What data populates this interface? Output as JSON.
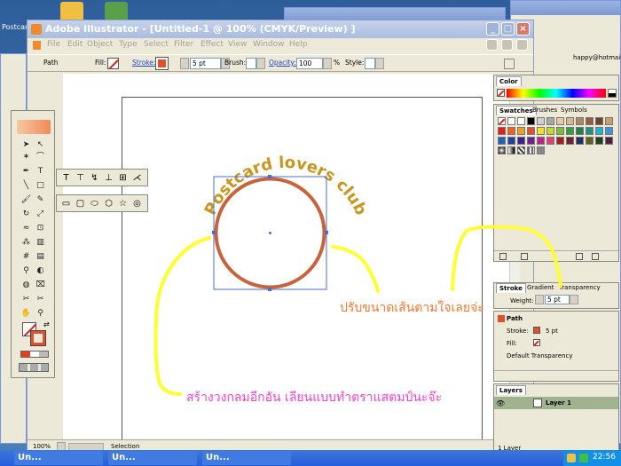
{
  "desktop": {
    "icon_postcard_label": "Postcard",
    "email_fragment": "happy@hotmail."
  },
  "window": {
    "title": "Adobe Illustrator - [Untitled-1 @ 100% (CMYK/Preview) ]",
    "minimize": "_",
    "maximize": "□",
    "close": "×"
  },
  "menu": [
    "File",
    "Edit",
    "Object",
    "Type",
    "Select",
    "Filter",
    "Effect",
    "View",
    "Window",
    "Help"
  ],
  "control_bar": {
    "object_label": "Path",
    "fill_label": "Fill:",
    "stroke_label": "Stroke:",
    "stroke_weight": "5 pt",
    "brush_label": "Brush:",
    "opacity_label": "Opacity:",
    "opacity_value": "100",
    "percent": "%",
    "style_label": "Style:"
  },
  "status_bar": {
    "zoom": "100%",
    "tool": "Selection"
  },
  "artwork": {
    "curved_text": "Postcard lovers club",
    "circle_stroke_color": "#c8643c",
    "text_color": "#c8961e"
  },
  "annotations": {
    "stroke_note": "ปรับขนาดเส้นตามใจเลยจ่ะ",
    "circle_note": "สร้างวงกลมอีกอัน  เลียนแบบทำตราแสตมป์นะจ๊ะ",
    "highlight_color": "#ffff33"
  },
  "panels": {
    "color": {
      "tab": "Color"
    },
    "swatches": {
      "tabs": [
        "Swatches",
        "Brushes",
        "Symbols"
      ]
    },
    "stroke": {
      "tabs": [
        "Stroke",
        "Gradient",
        "Transparency"
      ],
      "weight_label": "Weight:",
      "weight_value": "5 pt"
    },
    "appearance": {
      "title": "Path",
      "stroke_label": "Stroke:",
      "stroke_value": "5 pt",
      "fill_label": "Fill:",
      "transparency": "Default Transparency"
    },
    "layers": {
      "tab": "Layers",
      "layer_name": "Layer 1",
      "count": "1 Layer"
    }
  },
  "taskbar": {
    "buttons": [
      "Un...",
      "Un...",
      "Un..."
    ],
    "clock": "22:56"
  }
}
